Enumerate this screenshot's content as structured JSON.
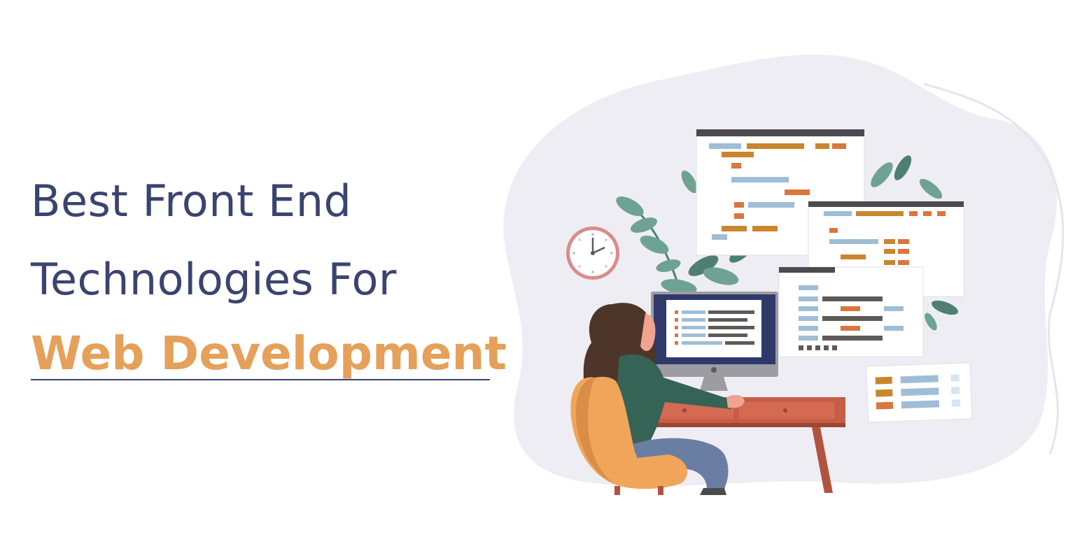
{
  "headline": {
    "line1": "Best Front End",
    "line2": "Technologies For",
    "line3": "Web Development"
  },
  "colors": {
    "navy": "#3a4470",
    "accent": "#e5a05a",
    "blob": "#efedf4",
    "code_orange": "#d9763f",
    "code_gold": "#c9862d",
    "code_blue": "#9fbdd6",
    "code_gray": "#5e5a5a",
    "leaf": "#6ea394",
    "leaf_dark": "#4e7f70",
    "desk": "#c65d46",
    "chair": "#f1a55a",
    "clock_ring": "#d98c88",
    "monitor": "#2f3a6a"
  },
  "icons": [
    "clock-icon",
    "plant-icon",
    "monitor-icon",
    "code-window-icon",
    "person-icon",
    "chair-icon",
    "desk-icon"
  ]
}
